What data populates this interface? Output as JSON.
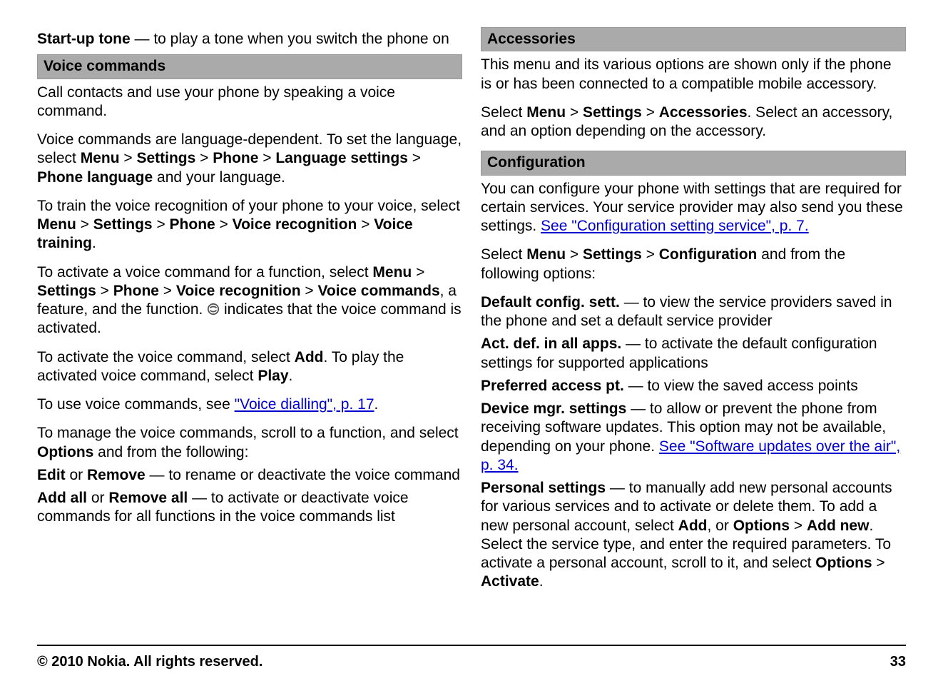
{
  "left": {
    "startup_tone_label": "Start-up tone",
    "startup_tone_desc": "  — to play a tone when you switch the phone on",
    "voice_commands_heading": "Voice commands",
    "vc_p1": "Call contacts and use your phone by speaking a voice command.",
    "vc_p2_pre": "Voice commands are language-dependent. To set the language, select ",
    "menu": "Menu",
    "gt": " > ",
    "settings": "Settings",
    "phone": "Phone",
    "lang_settings": "Language settings",
    "phone_lang": "Phone language",
    "vc_p2_post": " and your language.",
    "vc_p3_pre": "To train the voice recognition of your phone to your voice, select ",
    "voice_recog": "Voice recognition",
    "voice_training": "Voice training",
    "period": ".",
    "vc_p4_pre": "To activate a voice command for a function, select ",
    "voice_commands_bold": "Voice commands",
    "vc_p4_mid": ", a feature, and the function. ",
    "vc_p4_post": " indicates that the voice command is activated.",
    "vc_p5_pre": "To activate the voice command, select ",
    "add": "Add",
    "vc_p5_mid": ". To play the activated voice command, select ",
    "play": "Play",
    "vc_p6_pre": "To use voice commands, see ",
    "vc_p6_link": "\"Voice dialling\", p. 17",
    "vc_p7_pre": "To manage the voice commands, scroll to a function, and select ",
    "options": "Options",
    "vc_p7_post": " and from the following:",
    "edit": "Edit",
    "or": " or ",
    "remove": "Remove",
    "edit_remove_desc": " — to rename or deactivate the voice command",
    "add_all": "Add all",
    "remove_all": "Remove all",
    "addall_desc": " — to activate or deactivate voice commands for all functions in the voice commands list"
  },
  "right": {
    "accessories_heading": "Accessories",
    "acc_p1": "This menu and its various options are shown only if the phone is or has been connected to a compatible mobile accessory.",
    "acc_p2_pre": "Select ",
    "accessories": "Accessories",
    "acc_p2_post": ". Select an accessory, and an option depending on the accessory.",
    "config_heading": "Configuration",
    "cfg_p1_pre": "You can configure your phone with settings that are required for certain services. Your service provider may also send you these settings. ",
    "cfg_p1_link": "See \"Configuration setting service\", p. 7.",
    "cfg_p2_pre": "Select ",
    "configuration": "Configuration",
    "cfg_p2_post": " and from the following options:",
    "default_cfg": "Default config. sett.",
    "default_cfg_desc": "  — to view the service providers saved in the phone and set a default service provider",
    "act_def": "Act. def. in all apps.",
    "act_def_desc": "  — to activate the default configuration settings for supported applications",
    "pref_ap": "Preferred access pt.",
    "pref_ap_desc": "  — to view the saved access points",
    "dev_mgr": "Device mgr. settings",
    "dev_mgr_desc_pre": "  — to allow or prevent the phone from receiving software updates. This option may not be available, depending on your phone. ",
    "dev_mgr_link": "See \"Software updates over the air\", p. 34.",
    "personal": "Personal settings",
    "personal_desc_pre": "  — to manually add new personal accounts for various services and to activate or delete them. To add a new personal account, select ",
    "comma_or": ", or ",
    "add_new": "Add new",
    "personal_desc_mid": ". Select the service type, and enter the required parameters. To activate a personal account, scroll to it, and select ",
    "activate": "Activate",
    "footer_left": "© 2010 Nokia. All rights reserved.",
    "footer_right": "33"
  }
}
